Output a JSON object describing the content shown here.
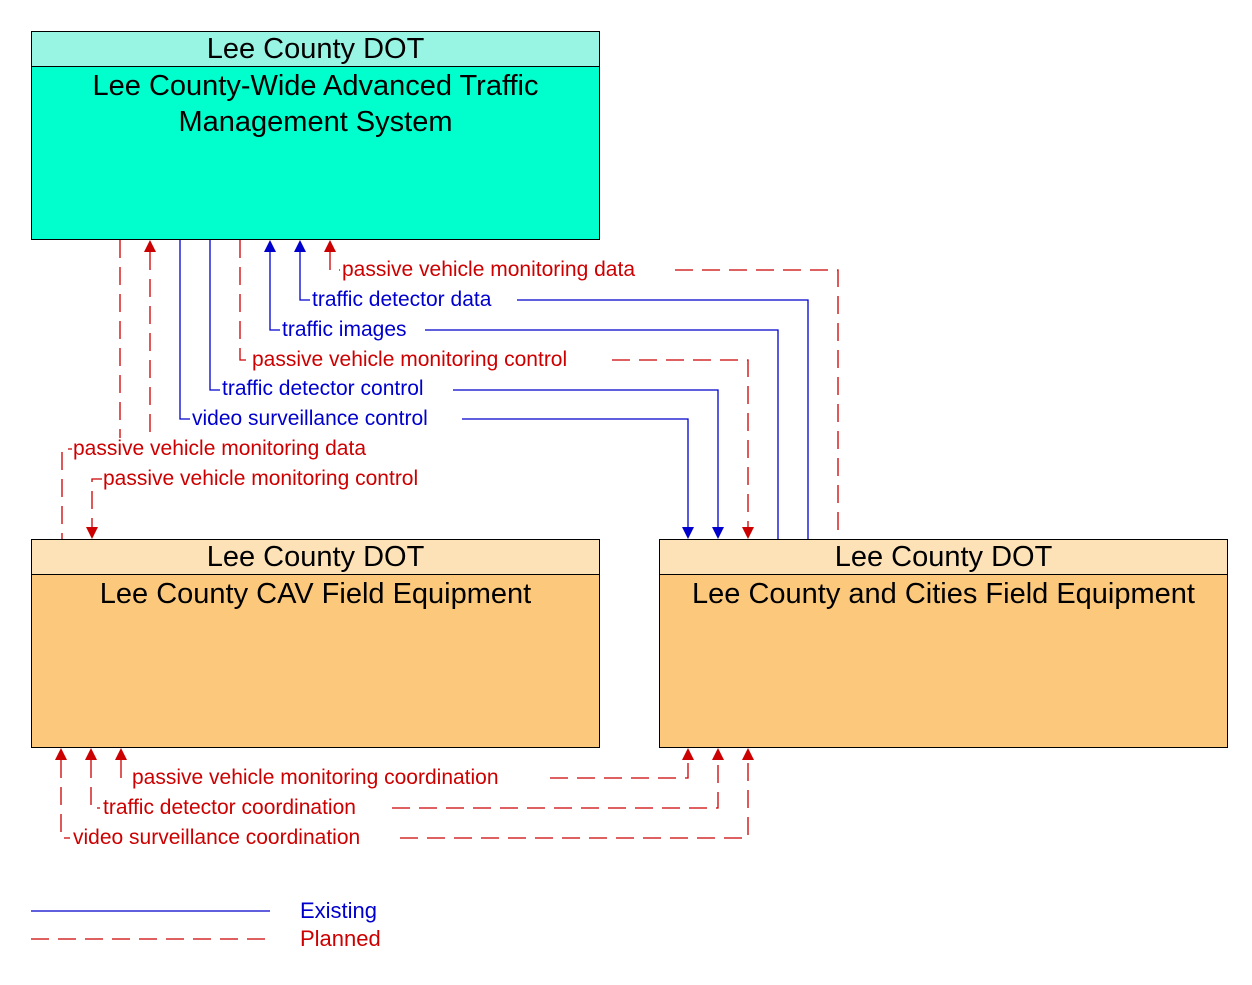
{
  "diagram": {
    "elements": [
      {
        "id": "atms",
        "owner": "Lee County DOT",
        "name": "Lee County-Wide Advanced Traffic\nManagement System",
        "fill": "#00ffcc",
        "header_fill": "#99f5e3"
      },
      {
        "id": "cav",
        "owner": "Lee County DOT",
        "name": "Lee County CAV Field Equipment",
        "fill": "#fcc97c",
        "header_fill": "#fde2b8"
      },
      {
        "id": "fe",
        "owner": "Lee County DOT",
        "name": "Lee County and Cities Field Equipment",
        "fill": "#fcc97c",
        "header_fill": "#fde2b8"
      }
    ],
    "flows": [
      {
        "label": "passive vehicle monitoring data",
        "from": "fe",
        "to": "atms",
        "status": "planned"
      },
      {
        "label": "traffic detector data",
        "from": "fe",
        "to": "atms",
        "status": "existing"
      },
      {
        "label": "traffic images",
        "from": "fe",
        "to": "atms",
        "status": "existing"
      },
      {
        "label": "passive vehicle monitoring control",
        "from": "atms",
        "to": "fe",
        "status": "planned"
      },
      {
        "label": "traffic detector control",
        "from": "atms",
        "to": "fe",
        "status": "existing"
      },
      {
        "label": "video surveillance control",
        "from": "atms",
        "to": "fe",
        "status": "existing"
      },
      {
        "label": "passive vehicle monitoring data",
        "from": "cav",
        "to": "atms",
        "status": "planned"
      },
      {
        "label": "passive vehicle monitoring control",
        "from": "atms",
        "to": "cav",
        "status": "planned"
      },
      {
        "label": "passive vehicle monitoring coordination",
        "from": "cav",
        "to": "fe",
        "status": "planned",
        "bidirectional": true
      },
      {
        "label": "traffic detector coordination",
        "from": "cav",
        "to": "fe",
        "status": "planned",
        "bidirectional": true
      },
      {
        "label": "video surveillance coordination",
        "from": "cav",
        "to": "fe",
        "status": "planned",
        "bidirectional": true
      }
    ],
    "legend": [
      {
        "label": "Existing",
        "status": "existing",
        "color": "#0000cc"
      },
      {
        "label": "Planned",
        "status": "planned",
        "color": "#cc0000"
      }
    ]
  }
}
